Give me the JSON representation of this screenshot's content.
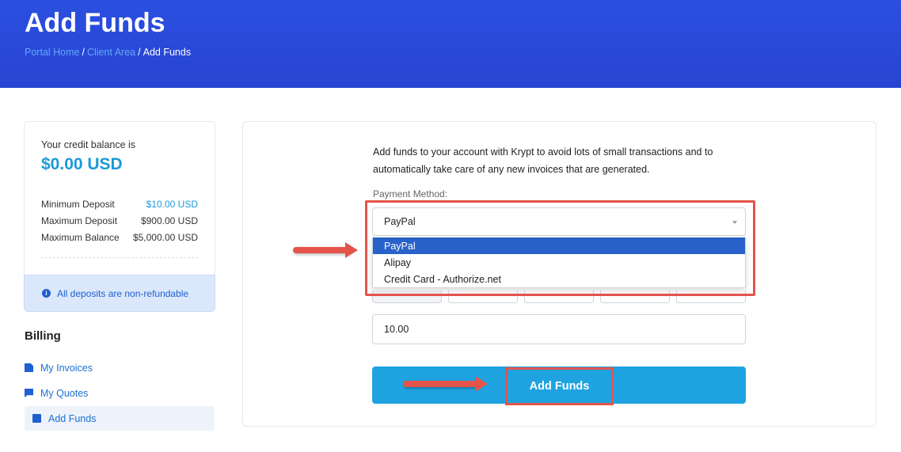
{
  "header": {
    "title": "Add Funds",
    "breadcrumb": [
      "Portal Home",
      "Client Area",
      "Add Funds"
    ],
    "breadcrumb_sep": "/"
  },
  "sidebar": {
    "credit_label": "Your credit balance is",
    "credit_amount": "$0.00 USD",
    "limits": [
      {
        "label": "Minimum Deposit",
        "value": "$10.00 USD"
      },
      {
        "label": "Maximum Deposit",
        "value": "$900.00 USD"
      },
      {
        "label": "Maximum Balance",
        "value": "$5,000.00 USD"
      }
    ],
    "notice": "All deposits are non-refundable",
    "billing_title": "Billing",
    "nav": [
      {
        "label": "My Invoices",
        "icon": "document-icon"
      },
      {
        "label": "My Quotes",
        "icon": "chat-icon"
      },
      {
        "label": "Add Funds",
        "icon": "funds-icon"
      }
    ]
  },
  "main": {
    "intro": "Add funds to your account with Krypt to avoid lots of small transactions and to automatically take care of any new invoices that are generated.",
    "payment_method_label": "Payment Method:",
    "payment_method_value": "PayPal",
    "options": [
      "PayPal",
      "Alipay",
      "Credit Card - Authorize.net"
    ],
    "amount_value": "10.00",
    "submit_label": "Add Funds"
  },
  "colors": {
    "header_bg": "#2a4bd8",
    "accent": "#1fa3e0",
    "annotation": "#e5534b",
    "selected_option": "#2861c9"
  }
}
